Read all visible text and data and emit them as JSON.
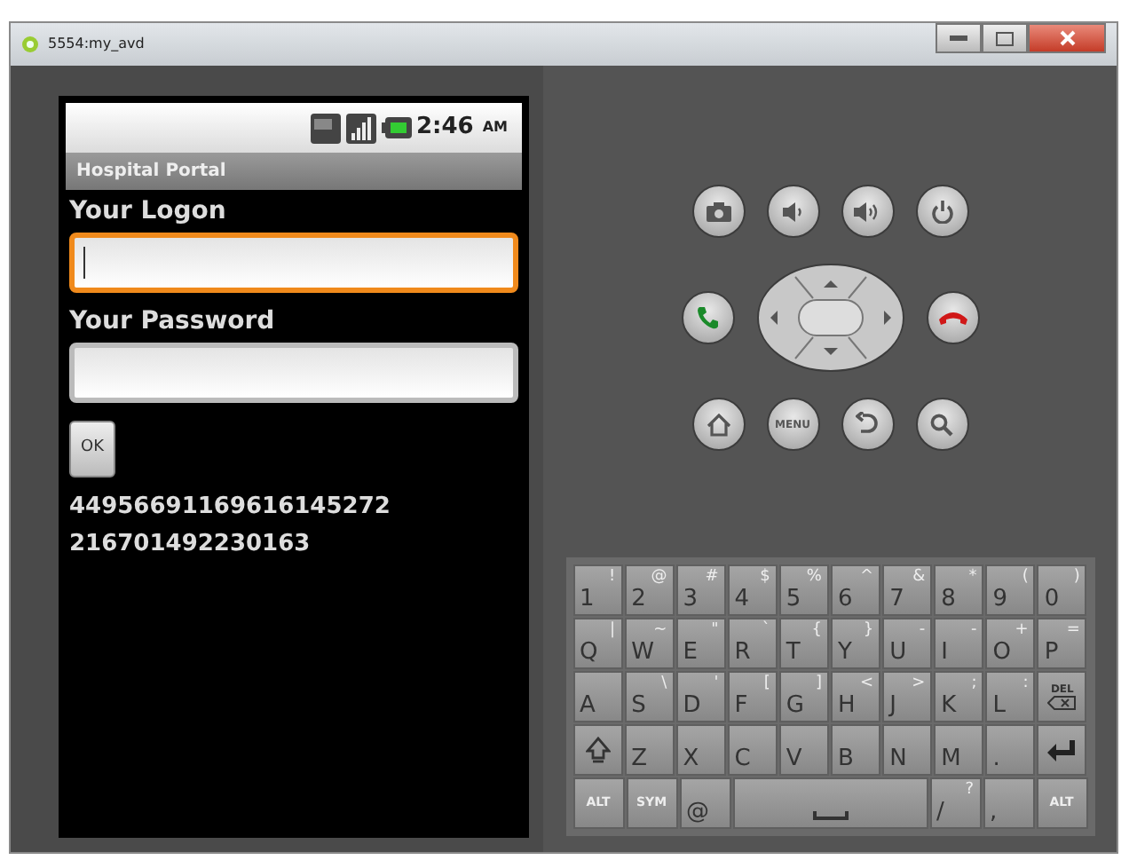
{
  "window": {
    "title": "5554:my_avd"
  },
  "status_bar": {
    "time": "2:46",
    "ampm": "AM"
  },
  "app": {
    "title": "Hospital Portal",
    "fields": [
      {
        "label": "Your Logon",
        "focused": true
      },
      {
        "label": "Your Password",
        "focused": false
      }
    ],
    "button": "OK",
    "output_lines": [
      "44956691169616145272",
      "216701492230163"
    ]
  },
  "controls": {
    "menu_label": "MENU"
  },
  "keyboard": {
    "rows": [
      [
        {
          "kind": "key",
          "label": "1",
          "alt": "!"
        },
        {
          "kind": "key",
          "label": "2",
          "alt": "@"
        },
        {
          "kind": "key",
          "label": "3",
          "alt": "#"
        },
        {
          "kind": "key",
          "label": "4",
          "alt": "$"
        },
        {
          "kind": "key",
          "label": "5",
          "alt": "%"
        },
        {
          "kind": "key",
          "label": "6",
          "alt": "^"
        },
        {
          "kind": "key",
          "label": "7",
          "alt": "&"
        },
        {
          "kind": "key",
          "label": "8",
          "alt": "*"
        },
        {
          "kind": "key",
          "label": "9",
          "alt": "("
        },
        {
          "kind": "key",
          "label": "0",
          "alt": ")"
        }
      ],
      [
        {
          "kind": "key",
          "label": "Q",
          "alt": "|"
        },
        {
          "kind": "key",
          "label": "W",
          "alt": "~"
        },
        {
          "kind": "key",
          "label": "E",
          "alt": "\""
        },
        {
          "kind": "key",
          "label": "R",
          "alt": "`"
        },
        {
          "kind": "key",
          "label": "T",
          "alt": "{"
        },
        {
          "kind": "key",
          "label": "Y",
          "alt": "}"
        },
        {
          "kind": "key",
          "label": "U",
          "alt": "-"
        },
        {
          "kind": "key",
          "label": "I",
          "alt": "-"
        },
        {
          "kind": "key",
          "label": "O",
          "alt": "+"
        },
        {
          "kind": "key",
          "label": "P",
          "alt": "="
        }
      ],
      [
        {
          "kind": "key",
          "label": "A"
        },
        {
          "kind": "key",
          "label": "S",
          "alt": "\\"
        },
        {
          "kind": "key",
          "label": "D",
          "alt": "'"
        },
        {
          "kind": "key",
          "label": "F",
          "alt": "["
        },
        {
          "kind": "key",
          "label": "G",
          "alt": "]"
        },
        {
          "kind": "key",
          "label": "H",
          "alt": "<"
        },
        {
          "kind": "key",
          "label": "J",
          "alt": ">"
        },
        {
          "kind": "key",
          "label": "K",
          "alt": ";"
        },
        {
          "kind": "key",
          "label": "L",
          "alt": ":"
        },
        {
          "kind": "del",
          "label": "DEL"
        }
      ],
      [
        {
          "kind": "shift"
        },
        {
          "kind": "key",
          "label": "Z"
        },
        {
          "kind": "key",
          "label": "X"
        },
        {
          "kind": "key",
          "label": "C"
        },
        {
          "kind": "key",
          "label": "V"
        },
        {
          "kind": "key",
          "label": "B"
        },
        {
          "kind": "key",
          "label": "N"
        },
        {
          "kind": "key",
          "label": "M"
        },
        {
          "kind": "key",
          "label": "."
        },
        {
          "kind": "enter"
        }
      ]
    ],
    "bottom_row": [
      {
        "kind": "mod",
        "label": "ALT"
      },
      {
        "kind": "mod",
        "label": "SYM"
      },
      {
        "kind": "key",
        "label": "@"
      },
      {
        "kind": "space"
      },
      {
        "kind": "key",
        "label": "/",
        "alt": "?"
      },
      {
        "kind": "key",
        "label": ","
      },
      {
        "kind": "mod",
        "label": "ALT"
      }
    ]
  }
}
